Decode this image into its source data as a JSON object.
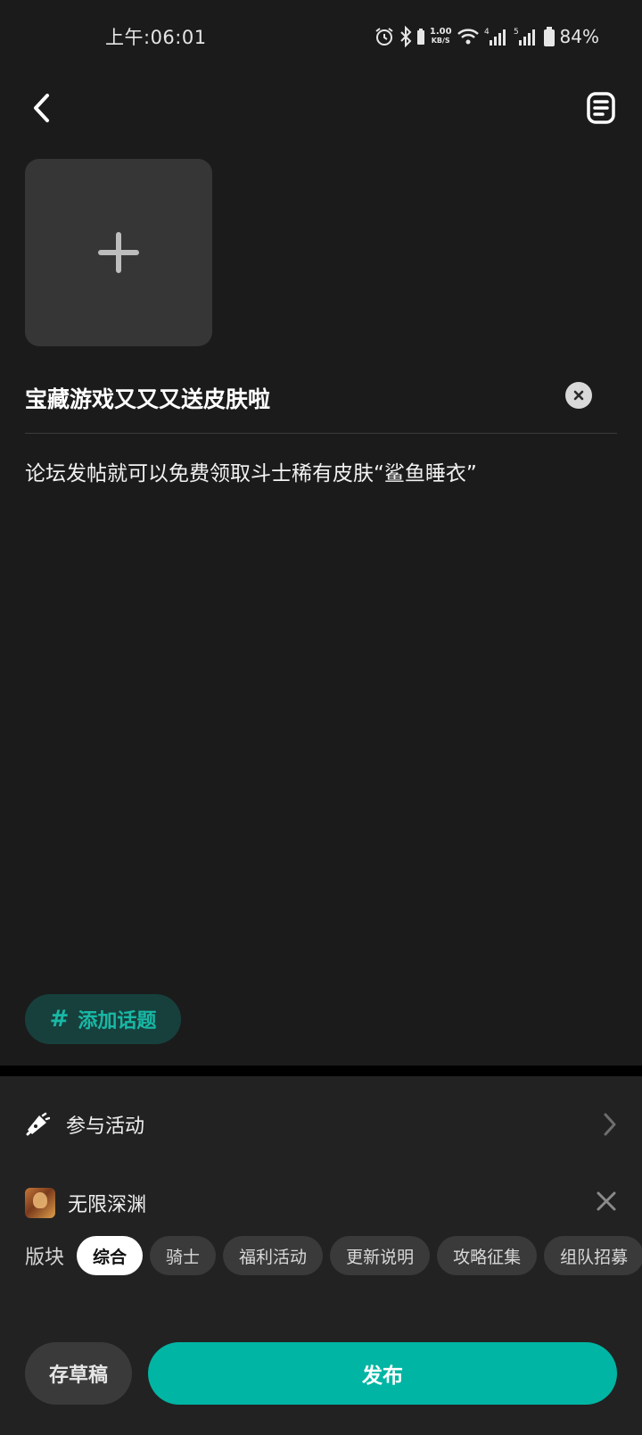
{
  "status_bar": {
    "time": "上午:06:01",
    "net_speed_value": "1.00",
    "net_speed_unit": "KB/S",
    "sim1_label": "4",
    "sim2_label": "5",
    "battery": "84%"
  },
  "post": {
    "title": "宝藏游戏又又又送皮肤啦",
    "body": "论坛发帖就可以免费领取斗士稀有皮肤“鲨鱼睡衣”"
  },
  "topic_button": {
    "hash": "#",
    "label": "添加话题"
  },
  "activity": {
    "label": "参与活动"
  },
  "game": {
    "name": "无限深渊"
  },
  "boards": {
    "label": "版块",
    "chips": [
      "综合",
      "骑士",
      "福利活动",
      "更新说明",
      "攻略征集",
      "组队招募"
    ],
    "selected": "综合"
  },
  "actions": {
    "draft_label": "存草稿",
    "publish_label": "发布"
  },
  "colors": {
    "background": "#1b1b1b",
    "panel": "#222222",
    "accent": "#00b5a3",
    "topic_bg": "#17403c"
  }
}
